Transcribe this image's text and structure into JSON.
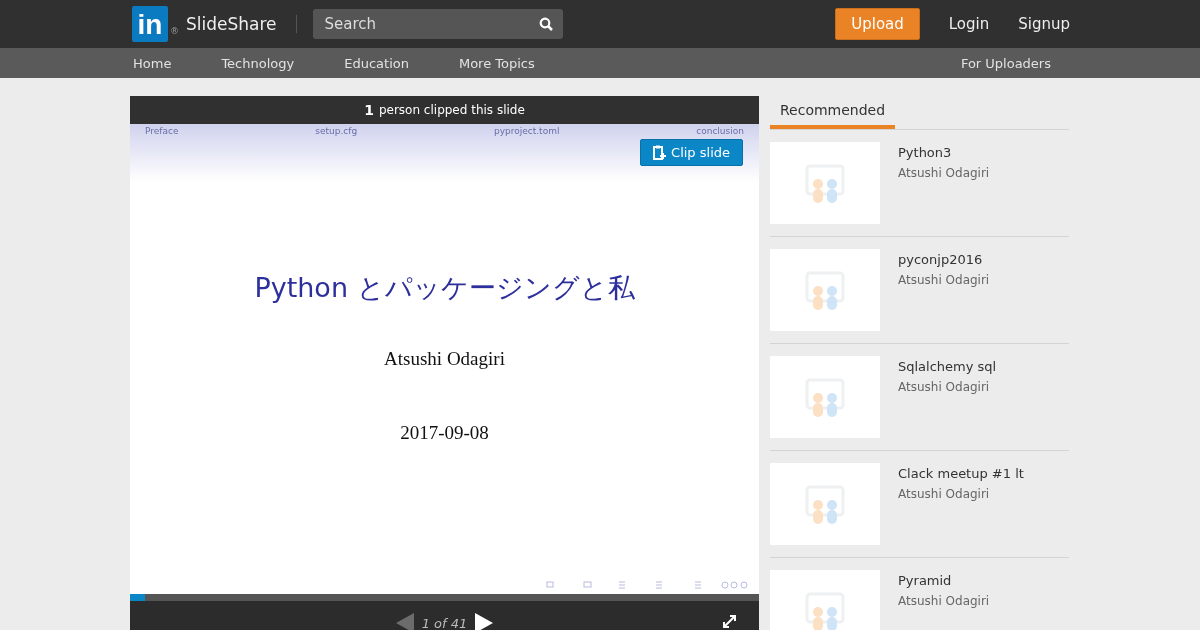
{
  "header": {
    "logo": "in",
    "registered": "®",
    "brand": "SlideShare",
    "search": {
      "placeholder": "Search"
    },
    "upload": "Upload",
    "links": [
      "Login",
      "Signup"
    ]
  },
  "nav": {
    "items": [
      "Home",
      "Technology",
      "Education",
      "More Topics"
    ],
    "right": "For Uploaders"
  },
  "viewer": {
    "clip_count": "1",
    "clip_text": "person clipped this slide",
    "clip_button": "Clip slide",
    "sections": [
      "Preface",
      "setup.cfg",
      "pyproject.toml",
      "conclusion"
    ],
    "slide": {
      "title": "Python とパッケージングと私",
      "author": "Atsushi Odagiri",
      "date": "2017-09-08"
    },
    "progress": {
      "level": 0.024
    },
    "page": "1 of 41",
    "prev_disabled": true,
    "next_disabled": false
  },
  "sidebar": {
    "tabs": [
      {
        "label": "Recommended",
        "selected": true
      }
    ],
    "items": [
      {
        "title": "Python3",
        "author": "Atsushi Odagiri"
      },
      {
        "title": "pyconjp2016",
        "author": "Atsushi Odagiri"
      },
      {
        "title": "Sqlalchemy sql",
        "author": "Atsushi Odagiri"
      },
      {
        "title": "Clack meetup #1 lt",
        "author": "Atsushi Odagiri"
      },
      {
        "title": "Pyramid",
        "author": "Atsushi Odagiri"
      }
    ]
  }
}
